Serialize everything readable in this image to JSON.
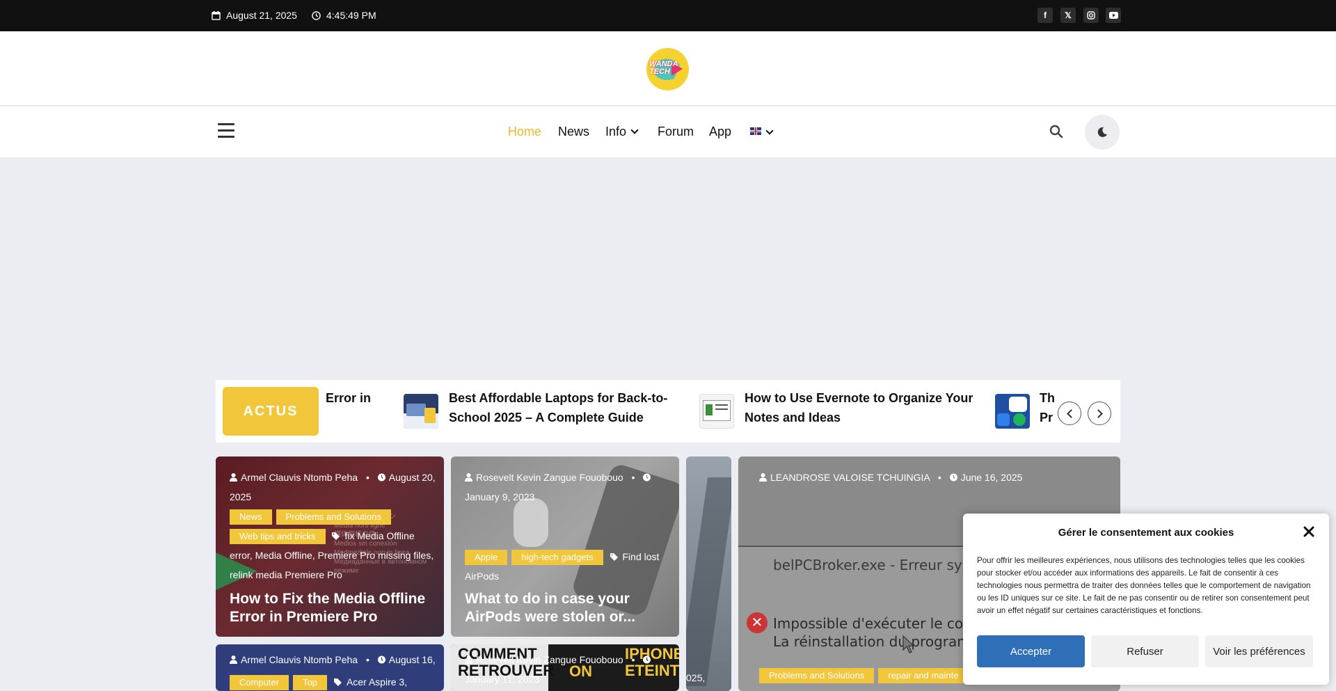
{
  "topbar": {
    "date": "August 21, 2025",
    "time": "4:45:49 PM",
    "social": [
      "facebook-icon",
      "x-icon",
      "instagram-icon",
      "youtube-icon"
    ]
  },
  "logo": {
    "text": "WANDA TECH"
  },
  "nav": {
    "items": [
      "Home",
      "News",
      "Info",
      "Forum",
      "App"
    ],
    "active": "Home",
    "language": "English"
  },
  "ticker": {
    "label": "ACTUS",
    "items": [
      "Error in",
      "Best Affordable Laptops for Back-to-School 2025 – A Complete Guide",
      "How to Use Evernote to Organize Your Notes and Ideas",
      "Th Pr"
    ]
  },
  "cards": [
    {
      "author": "Armel Clauvis Ntomb Peha",
      "date": "August 20, 2025",
      "categories": [
        "News",
        "Problems and Solutions",
        "Web tips and tricks"
      ],
      "tags": [
        "fix Media Offline error",
        "Media Offline",
        "Premiere Pro missing files",
        "relink media Premiere Pro"
      ],
      "title": "How to Fix the Media Offline Error in Premiere Pro"
    },
    {
      "author": "Rosevelt Kevin Zangue Fouobouo",
      "date": "January 9, 2023",
      "categories": [
        "Apple",
        "high-tech gadgets"
      ],
      "tags": [
        "Find lost AirPods"
      ],
      "title": "What to do in case your AirPods were stolen or..."
    },
    {
      "author": "LEANDROSE VALOISE TCHUINGIA",
      "date": "June 16, 2025",
      "categories": [
        "Problems and Solutions",
        "repair and mainte"
      ],
      "screen_text": [
        "belPCBroker.exe - Erreur système",
        "Impossible d'exécuter le code, car",
        "La réinstallation du programme p"
      ]
    },
    {
      "author": "Armel Clauvis Ntomb Peha",
      "date": "August 16, 2025",
      "categories": [
        "Computer",
        "Top"
      ],
      "tags": [
        "Acer Aspire 3,"
      ]
    },
    {
      "author": "Rosevelt Kevin Zangue Fouobouo",
      "date": "January 11, 2023",
      "image_text": [
        "COMMENT",
        "RETROUVER",
        "IPHONE",
        "ETEINT",
        "ON"
      ]
    }
  ],
  "partial_card": {
    "date": "025,"
  },
  "cookie": {
    "title": "Gérer le consentement aux cookies",
    "text": "Pour offrir les meilleures expériences, nous utilisons des technologies telles que les cookies pour stocker et/ou accéder aux informations des appareils. Le fait de consentir à ces technologies nous permettra de traiter des données telles que le comportement de navigation ou les ID uniques sur ce site. Le fait de ne pas consentir ou de retirer son consentement peut avoir un effet négatif sur certaines caractéristiques et fonctions.",
    "accept": "Accepter",
    "refuse": "Refuser",
    "prefs": "Voir les préférences"
  },
  "colors": {
    "accent": "#f2c63a",
    "nav_active": "#e8b923",
    "primary_button": "#2f6fb8",
    "topbar": "#111111"
  }
}
